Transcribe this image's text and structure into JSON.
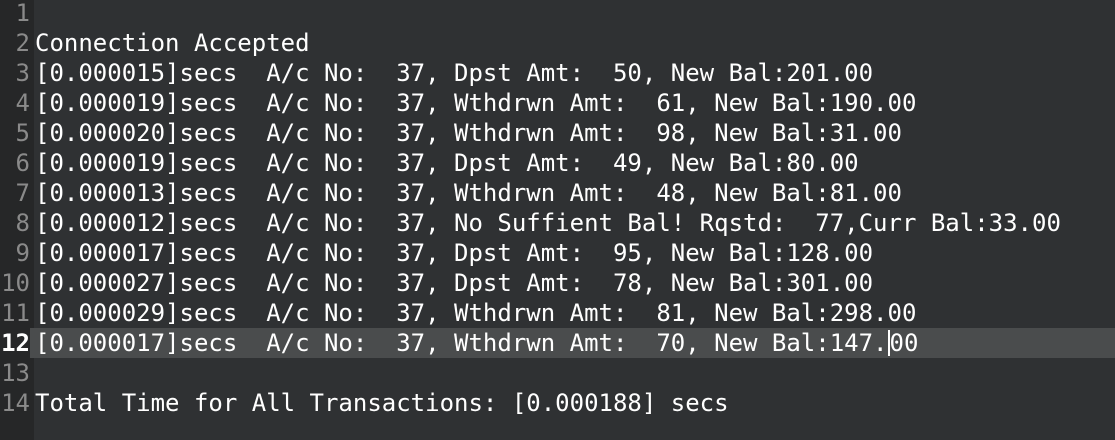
{
  "editor": {
    "lines": [
      {
        "number": "1",
        "text": ""
      },
      {
        "number": "2",
        "text": "Connection Accepted"
      },
      {
        "number": "3",
        "text": "[0.000015]secs  A/c No:  37, Dpst Amt:  50, New Bal:201.00"
      },
      {
        "number": "4",
        "text": "[0.000019]secs  A/c No:  37, Wthdrwn Amt:  61, New Bal:190.00"
      },
      {
        "number": "5",
        "text": "[0.000020]secs  A/c No:  37, Wthdrwn Amt:  98, New Bal:31.00"
      },
      {
        "number": "6",
        "text": "[0.000019]secs  A/c No:  37, Dpst Amt:  49, New Bal:80.00"
      },
      {
        "number": "7",
        "text": "[0.000013]secs  A/c No:  37, Wthdrwn Amt:  48, New Bal:81.00"
      },
      {
        "number": "8",
        "text": "[0.000012]secs  A/c No:  37, No Suffient Bal! Rqstd:  77,Curr Bal:33.00"
      },
      {
        "number": "9",
        "text": "[0.000017]secs  A/c No:  37, Dpst Amt:  95, New Bal:128.00"
      },
      {
        "number": "10",
        "text": "[0.000027]secs  A/c No:  37, Dpst Amt:  78, New Bal:301.00"
      },
      {
        "number": "11",
        "text": "[0.000029]secs  A/c No:  37, Wthdrwn Amt:  81, New Bal:298.00"
      },
      {
        "number": "12",
        "text_before_cursor": "[0.000017]secs  A/c No:  37, Wthdrwn Amt:  70, New Bal:147.",
        "text_after_cursor": "00"
      },
      {
        "number": "13",
        "text": ""
      },
      {
        "number": "14",
        "text": "Total Time for All Transactions: [0.000188] secs"
      }
    ]
  }
}
